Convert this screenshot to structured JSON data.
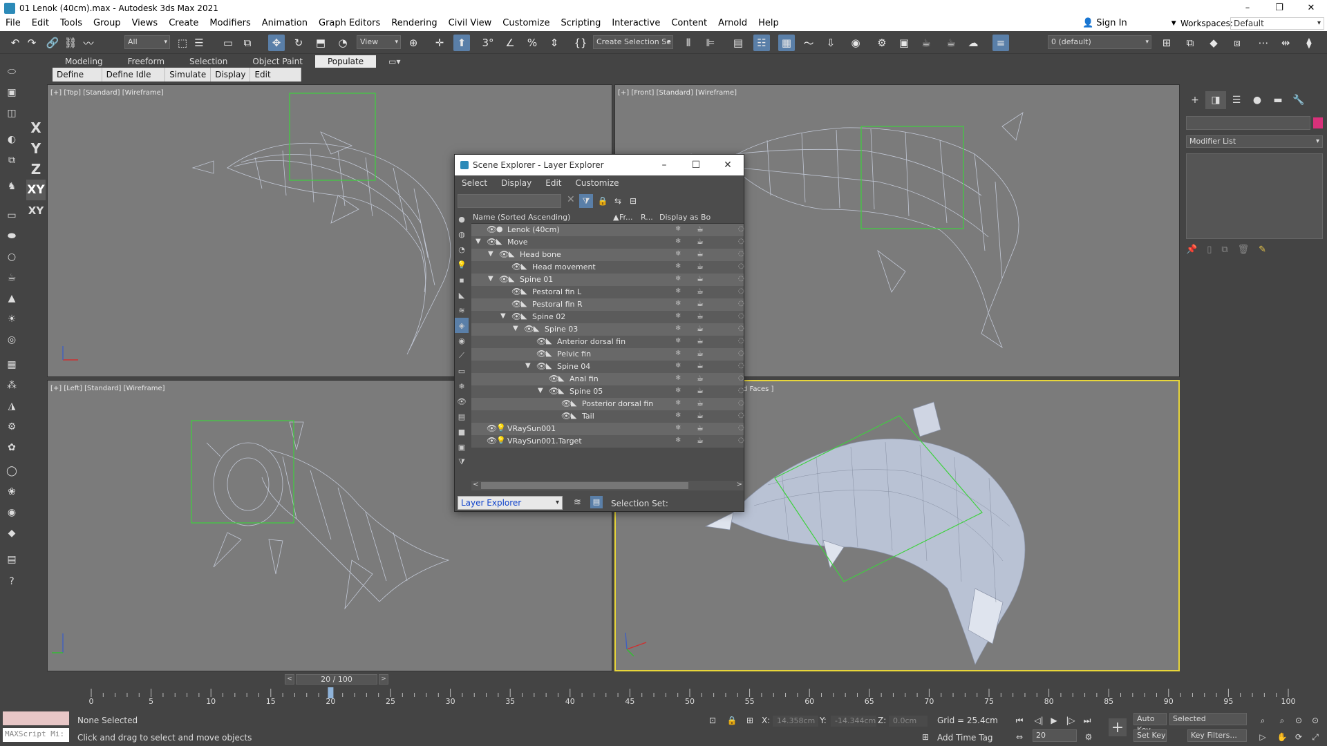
{
  "window": {
    "title": "01 Lenok (40cm).max - Autodesk 3ds Max 2021",
    "buttons": [
      "–",
      "❐",
      "✕"
    ]
  },
  "menubar": {
    "items": [
      "File",
      "Edit",
      "Tools",
      "Group",
      "Views",
      "Create",
      "Modifiers",
      "Animation",
      "Graph Editors",
      "Rendering",
      "Civil View",
      "Customize",
      "Scripting",
      "Interactive",
      "Content",
      "Arnold",
      "Help"
    ],
    "sign_in": "Sign In",
    "workspaces_label": "Workspaces:",
    "workspace_value": "Default"
  },
  "toolbar": {
    "selection_filter": "All",
    "ref_coord": "View",
    "named_selection": "Create Selection Se",
    "layer": "0 (default)"
  },
  "ribbon": {
    "tabs": [
      "Modeling",
      "Freeform",
      "Selection",
      "Object Paint",
      "Populate"
    ],
    "active_tab": "Populate",
    "commands": [
      "Define Flows",
      "Define Idle Areas",
      "Simulate",
      "Display",
      "Edit Selected"
    ]
  },
  "axes": [
    "X",
    "Y",
    "Z",
    "XY",
    "XY"
  ],
  "viewports": {
    "top": "[+] [Top] [Standard] [Wireframe]",
    "front": "[+] [Front] [Standard] [Wireframe]",
    "left": "[+] [Left] [Standard] [Wireframe]",
    "persp": "d Faces ]"
  },
  "command_panel": {
    "modifier_list": "Modifier List",
    "name_color": "#d8317a"
  },
  "scene_explorer": {
    "title": "Scene Explorer - Layer Explorer",
    "menu": [
      "Select",
      "Display",
      "Edit",
      "Customize"
    ],
    "columns": {
      "name": "Name (Sorted Ascending)",
      "frozen": "Fr...",
      "render": "R...",
      "display": "Display as Bo"
    },
    "rows": [
      {
        "name": "Lenok (40cm)",
        "depth": 0,
        "expander": "",
        "kind": "layer",
        "hi": true
      },
      {
        "name": "Move",
        "depth": 0,
        "expander": "▼",
        "kind": "bone",
        "hi": false
      },
      {
        "name": "Head bone",
        "depth": 1,
        "expander": "▼",
        "kind": "bone",
        "hi": true
      },
      {
        "name": "Head movement",
        "depth": 2,
        "expander": "",
        "kind": "bone",
        "hi": false
      },
      {
        "name": "Spine 01",
        "depth": 1,
        "expander": "▼",
        "kind": "bone",
        "hi": true
      },
      {
        "name": "Pestoral fin L",
        "depth": 2,
        "expander": "",
        "kind": "bone",
        "hi": false
      },
      {
        "name": "Pestoral fin R",
        "depth": 2,
        "expander": "",
        "kind": "bone",
        "hi": true
      },
      {
        "name": "Spine 02",
        "depth": 2,
        "expander": "▼",
        "kind": "bone",
        "hi": false
      },
      {
        "name": "Spine 03",
        "depth": 3,
        "expander": "▼",
        "kind": "bone",
        "hi": true
      },
      {
        "name": "Anterior dorsal fin",
        "depth": 4,
        "expander": "",
        "kind": "bone",
        "hi": false
      },
      {
        "name": "Pelvic fin",
        "depth": 4,
        "expander": "",
        "kind": "bone",
        "hi": true
      },
      {
        "name": "Spine 04",
        "depth": 4,
        "expander": "▼",
        "kind": "bone",
        "hi": false
      },
      {
        "name": "Anal fin",
        "depth": 5,
        "expander": "",
        "kind": "bone",
        "hi": true
      },
      {
        "name": "Spine 05",
        "depth": 5,
        "expander": "▼",
        "kind": "bone",
        "hi": false
      },
      {
        "name": "Posterior dorsal fin",
        "depth": 6,
        "expander": "",
        "kind": "bone",
        "hi": true
      },
      {
        "name": "Tail",
        "depth": 6,
        "expander": "",
        "kind": "bone",
        "hi": false
      },
      {
        "name": "VRaySun001",
        "depth": 0,
        "expander": "",
        "kind": "light",
        "hi": true
      },
      {
        "name": "VRaySun001.Target",
        "depth": 0,
        "expander": "",
        "kind": "light",
        "hi": false
      }
    ],
    "layer_dropdown": "Layer Explorer",
    "selection_set": "Selection Set:"
  },
  "timeline": {
    "frame_display": "20 / 100",
    "ticks": [
      "0",
      "5",
      "10",
      "15",
      "20",
      "25",
      "30",
      "35",
      "40",
      "45",
      "50",
      "55",
      "60",
      "65",
      "70",
      "75",
      "80",
      "85",
      "90",
      "95",
      "100"
    ]
  },
  "status": {
    "maxscript": "MAXScript Mi:",
    "selection": "None Selected",
    "prompt": "Click and drag to select and move objects",
    "x_label": "X:",
    "x_value": "14.358cm",
    "y_label": "Y:",
    "y_value": "-14.344cm",
    "z_label": "Z:",
    "z_value": "0.0cm",
    "grid": "Grid = 25.4cm",
    "add_time_tag": "Add Time Tag",
    "auto_key": "Auto Key",
    "selected": "Selected",
    "set_key": "Set Key",
    "key_filters": "Key Filters...",
    "frame": "20"
  }
}
